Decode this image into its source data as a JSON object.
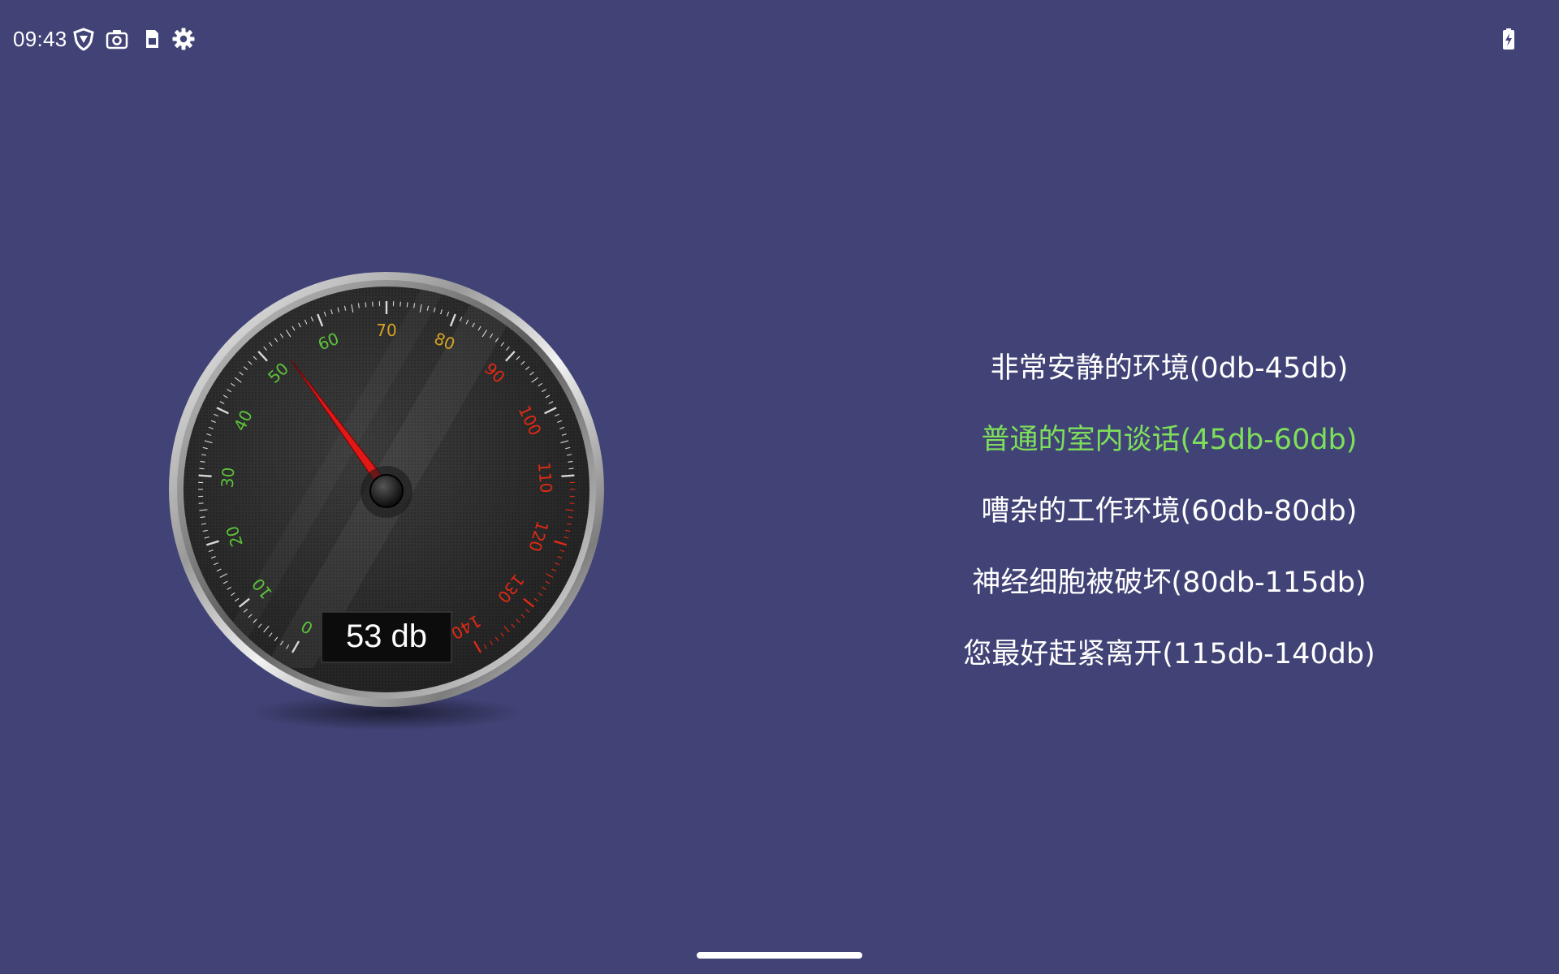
{
  "status_bar": {
    "time": "09:43",
    "icons": [
      "vpn-shield-icon",
      "camera-icon",
      "sim-card-icon",
      "settings-gear-icon",
      "battery-charging-icon"
    ]
  },
  "gauge": {
    "unit": "db",
    "value": 53,
    "readout": "53 db",
    "min": 0,
    "max": 140,
    "tick_labels": [
      "0",
      "10",
      "20",
      "30",
      "40",
      "50",
      "60",
      "70",
      "80",
      "90",
      "100",
      "110",
      "120",
      "130",
      "140"
    ],
    "colors": {
      "low": "#5cc33a",
      "mid": "#d6a423",
      "high": "#e02a14",
      "needle": "#e01818"
    }
  },
  "legend": {
    "items": [
      {
        "text": "非常安静的环境(0db-45db)",
        "color": "#ffffff",
        "active": false
      },
      {
        "text": "普通的室内谈话(45db-60db)",
        "color": "#7ee05a",
        "active": true
      },
      {
        "text": "嘈杂的工作环境(60db-80db)",
        "color": "#ffffff",
        "active": false
      },
      {
        "text": "神经细胞被破坏(80db-115db)",
        "color": "#ffffff",
        "active": false
      },
      {
        "text": "您最好赶紧离开(115db-140db)",
        "color": "#ffffff",
        "active": false
      }
    ]
  }
}
